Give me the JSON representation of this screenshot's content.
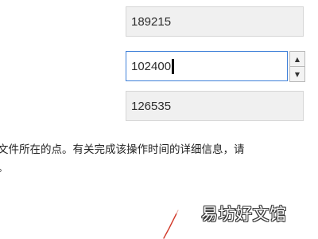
{
  "fields": {
    "top_value": "189215",
    "middle_value": "102400",
    "bottom_value": "126535"
  },
  "spinner": {
    "up_icon": "▲",
    "down_icon": "▼"
  },
  "description": {
    "line1": "文件所在的点。有关完成该操作时间的详细信息，请",
    "line2": "。"
  },
  "watermark": "易坊好文馆",
  "colors": {
    "focus_border": "#3f80d8",
    "readonly_bg": "#f0f0f0",
    "annotation_red": "#d23a2a"
  }
}
